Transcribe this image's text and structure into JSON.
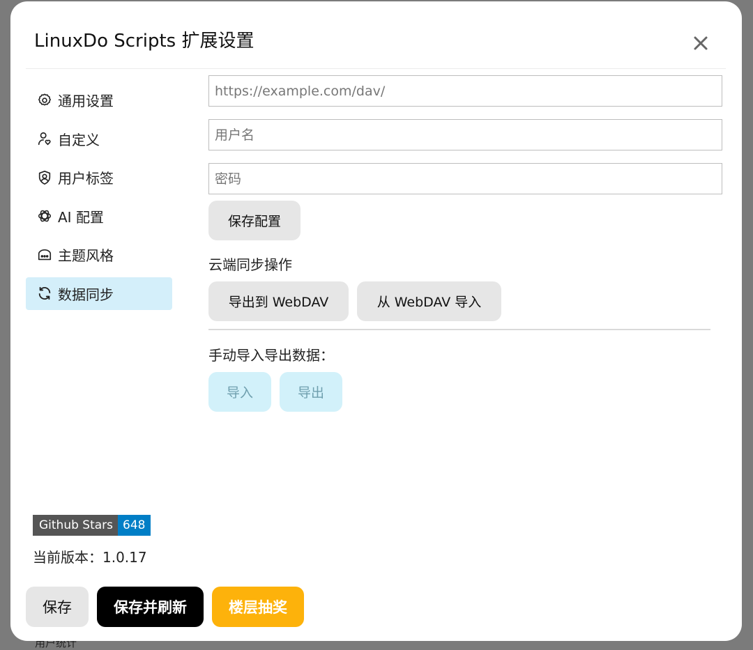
{
  "background_hint": "用户统计",
  "modal": {
    "title": "LinuxDo Scripts 扩展设置",
    "close_icon": "close-icon"
  },
  "sidebar": {
    "items": [
      {
        "label": "通用设置",
        "icon": "gear-icon",
        "active": false
      },
      {
        "label": "自定义",
        "icon": "user-heart-icon",
        "active": false
      },
      {
        "label": "用户标签",
        "icon": "user-shield-icon",
        "active": false
      },
      {
        "label": "AI 配置",
        "icon": "ai-flower-icon",
        "active": false
      },
      {
        "label": "主题风格",
        "icon": "theme-box-icon",
        "active": false
      },
      {
        "label": "数据同步",
        "icon": "sync-icon",
        "active": true
      }
    ]
  },
  "webdav": {
    "url_placeholder": "https://example.com/dav/",
    "url_value": "",
    "username_placeholder": "用户名",
    "username_value": "",
    "password_placeholder": "密码",
    "password_value": "",
    "save_config_label": "保存配置"
  },
  "cloud_sync": {
    "heading": "云端同步操作",
    "export_label": "导出到 WebDAV",
    "import_label": "从 WebDAV 导入"
  },
  "manual": {
    "heading": "手动导入导出数据：",
    "import_label": "导入",
    "export_label": "导出"
  },
  "github_badge": {
    "label": "Github Stars",
    "count": "648"
  },
  "version": {
    "label": "当前版本：",
    "value": "1.0.17"
  },
  "footer": {
    "save_label": "保存",
    "save_refresh_label": "保存并刷新",
    "lottery_label": "楼层抽奖"
  },
  "colors": {
    "active_nav_bg": "#d4effa",
    "badge_left": "#555555",
    "badge_right": "#007ec6",
    "lottery": "#fdb20b",
    "save_refresh": "#000000"
  }
}
